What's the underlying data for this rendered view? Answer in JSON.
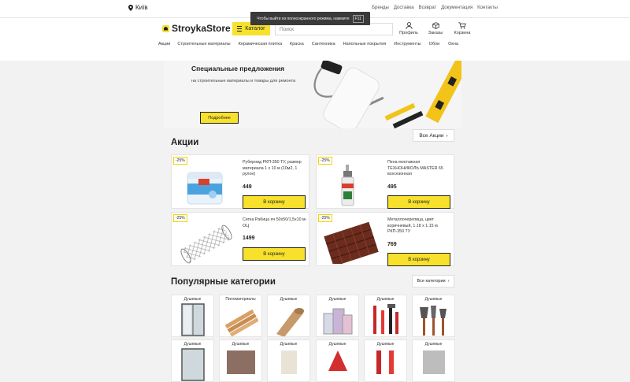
{
  "topbar": {
    "city": "Київ",
    "links": [
      "Бренды",
      "Доставка",
      "Возврат",
      "Документация",
      "Контакты"
    ],
    "toast_text": "Чтобы выйти из полноэкранного режима, нажмите",
    "toast_key": "F11"
  },
  "header": {
    "logo": "StroykaStore",
    "catalog_label": "Каталог",
    "search_placeholder": "Поиск",
    "icons": [
      {
        "icon": "user-icon",
        "label": "Профиль"
      },
      {
        "icon": "box-icon",
        "label": "Заказы"
      },
      {
        "icon": "cart-icon",
        "label": "Корзина"
      }
    ]
  },
  "nav": [
    "Акции",
    "Строительные материалы",
    "Керамическая плитка",
    "Краска",
    "Сантехника",
    "Напольные покрытия",
    "Инструменты",
    "Обои",
    "Окна"
  ],
  "hero": {
    "title": "Специальные предложения",
    "subtitle": "на строительные материалы и товары для ремонта",
    "button": "Подробнее"
  },
  "promo": {
    "title": "Акции",
    "all_label": "Все Акции",
    "products": [
      {
        "badge": "-25%",
        "name": "Рубероид РКП-350 ТУ, размер материала 1 х 10 м (10м2, 1 рулон)",
        "price": "449",
        "button": "В корзину",
        "icon": "paint-bucket-image"
      },
      {
        "badge": "-25%",
        "name": "Пена монтажная ТЕХНОНИКОЛЬ MASTER 65 всесезонная",
        "price": "495",
        "button": "В корзину",
        "icon": "foam-can-image"
      },
      {
        "badge": "-25%",
        "name": "Сетка Рабица яч 50х50/1,5х10 м-ОЦ",
        "price": "1499",
        "button": "В корзину",
        "icon": "mesh-roll-image"
      },
      {
        "badge": "-25%",
        "name": "Металлочерепица, цвет коричневый, 1.18 х 1.15 м РКП-350 ТУ",
        "price": "769",
        "button": "В корзину",
        "icon": "roof-tile-image"
      }
    ]
  },
  "categories": {
    "title": "Популярные категории",
    "all_label": "Все категории",
    "items": [
      {
        "label": "Душевые",
        "icon": "shower-cabin-image"
      },
      {
        "label": "Пиломатериалы",
        "icon": "lumber-image"
      },
      {
        "label": "Душевые",
        "icon": "paper-roll-image"
      },
      {
        "label": "Душевые",
        "icon": "paint-cans-image"
      },
      {
        "label": "Душевые",
        "icon": "hand-tools-image"
      },
      {
        "label": "Душевые",
        "icon": "garden-tools-image"
      },
      {
        "label": "Душевые",
        "icon": "shower-cabin-image"
      },
      {
        "label": "Душевые",
        "icon": "lumber-image"
      },
      {
        "label": "Душевые",
        "icon": "paper-roll-image"
      },
      {
        "label": "Душевые",
        "icon": "paint-cans-image"
      },
      {
        "label": "Душевые",
        "icon": "hand-tools-image"
      },
      {
        "label": "Душевые",
        "icon": "garden-tools-image"
      }
    ]
  },
  "colors": {
    "accent": "#f7e12c",
    "background": "#f2f2f2"
  }
}
